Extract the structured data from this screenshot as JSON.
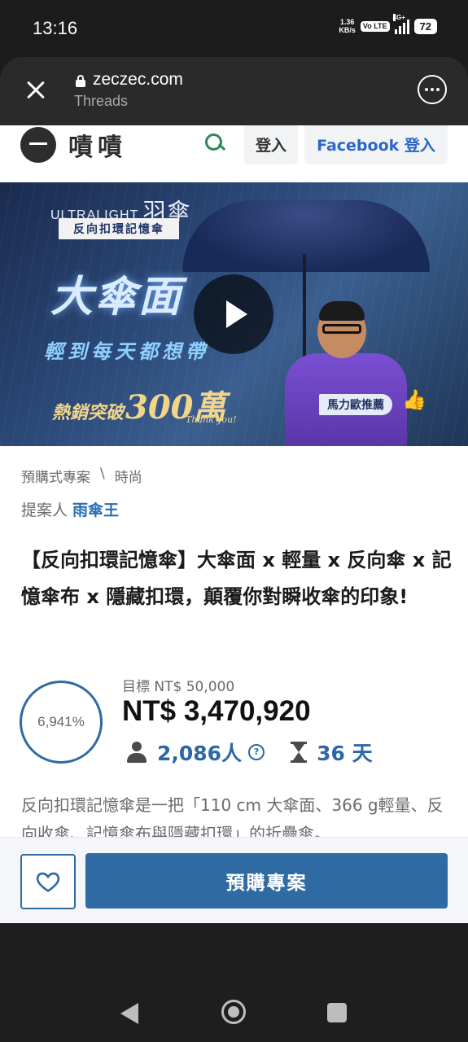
{
  "status_bar": {
    "time": "13:16",
    "net_speed_value": "1.36",
    "net_speed_unit": "KB/s",
    "volte": "Vo LTE",
    "signal_label": "4G+",
    "battery": "72"
  },
  "browser": {
    "url": "zeczec.com",
    "subtitle": "Threads"
  },
  "site_header": {
    "logo_text": "嘖嘖",
    "login_label": "登入",
    "fb_login_label": "Facebook 登入"
  },
  "hero": {
    "brand": "ULTRALIGHT",
    "brand_cn": "羽傘",
    "badge": "反向扣環記憶傘",
    "headline": "大傘面",
    "subline": "輕到每天都想帶",
    "sales_prefix": "熱銷突破",
    "sales_number": "300萬",
    "thanks": "Thank you!",
    "endorse_tag": "馬力歐推薦"
  },
  "project": {
    "breadcrumb_category": "預購式專案",
    "breadcrumb_separator": "\\",
    "breadcrumb_sub": "時尚",
    "proposer_label": "提案人",
    "proposer_name": "雨傘王",
    "title": "【反向扣環記憶傘】大傘面 x 輕量 x 反向傘 x 記憶傘布 x 隱藏扣環，顛覆你對瞬收傘的印象!",
    "progress_percent": "6,941%",
    "goal": "目標 NT$ 50,000",
    "amount": "NT$ 3,470,920",
    "backers": "2,086人",
    "help": "?",
    "days_left": "36 天",
    "description": "反向扣環記憶傘是一把「110 cm 大傘面、366 g輕量、反向收傘、記憶傘布與隱藏扣環」的折疊傘。"
  },
  "actions": {
    "preorder_label": "預購專案"
  },
  "colors": {
    "primary": "#2f6aa3",
    "link": "#2a6fb0",
    "search_green": "#2a8a5a",
    "facebook_blue": "#2b66c8"
  }
}
